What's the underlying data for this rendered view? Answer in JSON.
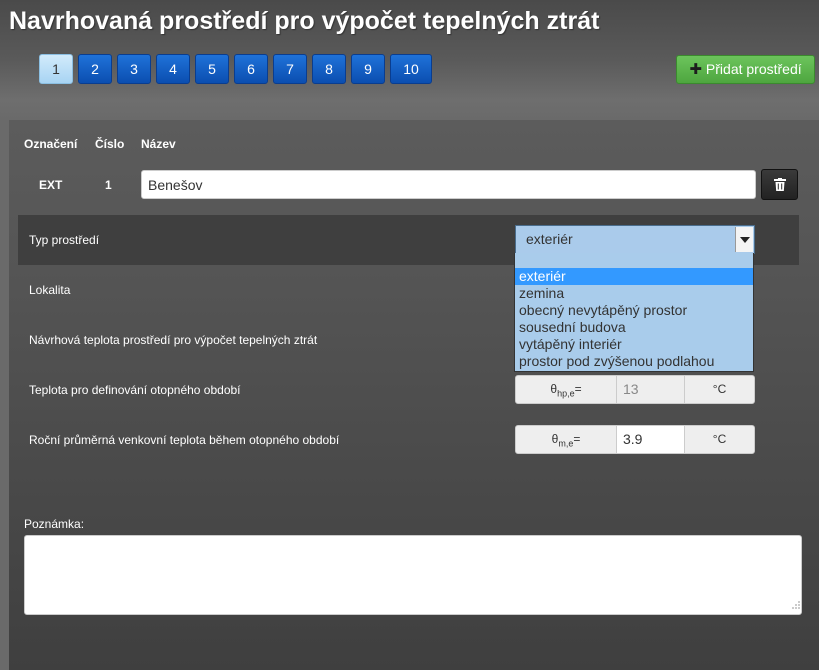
{
  "page": {
    "title": "Navrhovaná prostředí pro výpočet tepelných ztrát"
  },
  "pager": {
    "pages": [
      "1",
      "2",
      "3",
      "4",
      "5",
      "6",
      "7",
      "8",
      "9",
      "10"
    ],
    "active": "1"
  },
  "toolbar": {
    "add_label": "Přidat prostředí",
    "add_icon": "plus-icon"
  },
  "table": {
    "headers": {
      "designation": "Označení",
      "number": "Číslo",
      "name": "Název"
    },
    "row": {
      "designation": "EXT",
      "number": "1",
      "name": "Benešov"
    },
    "delete_icon": "trash-icon"
  },
  "form": {
    "type_label": "Typ prostředí",
    "type_value": "exteriér",
    "type_options": [
      "exteriér",
      "zemina",
      "obecný nevytápěný prostor",
      "sousední budova",
      "vytápěný interiér",
      "prostor pod zvýšenou podlahou"
    ],
    "locality_label": "Lokalita",
    "design_temp_label": "Návrhová teplota prostředí pro výpočet tepelných ztrát",
    "heating_temp_label": "Teplota pro definování otopného období",
    "heating_temp": {
      "symbol": "θ",
      "subscript": "hp,e",
      "eq": "=",
      "value": "13",
      "unit": "°C"
    },
    "avg_temp_label": "Roční průměrná venkovní teplota během otopného období",
    "avg_temp": {
      "symbol": "θ",
      "subscript": "m,e",
      "eq": "=",
      "value": "3.9",
      "unit": "°C"
    },
    "note_label": "Poznámka:",
    "note_value": ""
  },
  "colors": {
    "primary": "#0b4eb0",
    "success": "#4ea63f",
    "select_bg": "#aacbeb",
    "selected_option": "#3399ff"
  }
}
